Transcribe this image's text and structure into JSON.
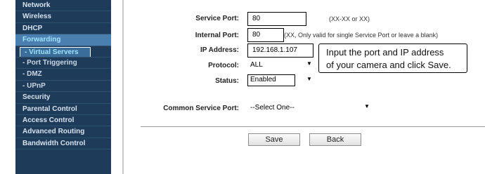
{
  "sidebar": {
    "items": [
      {
        "label": "Network"
      },
      {
        "label": "Wireless"
      },
      {
        "label": "DHCP"
      },
      {
        "label": "Forwarding"
      },
      {
        "label": "- Virtual Servers"
      },
      {
        "label": "- Port Triggering"
      },
      {
        "label": "- DMZ"
      },
      {
        "label": "- UPnP"
      },
      {
        "label": "Security"
      },
      {
        "label": "Parental Control"
      },
      {
        "label": "Access Control"
      },
      {
        "label": "Advanced Routing"
      },
      {
        "label": "Bandwidth Control"
      }
    ]
  },
  "form": {
    "service_port": {
      "label": "Service Port:",
      "value": "80",
      "hint": "(XX-XX or XX)"
    },
    "internal_port": {
      "label": "Internal Port:",
      "value": "80",
      "hint": "(XX, Only valid for single Service Port or leave a blank)"
    },
    "ip_address": {
      "label": "IP Address:",
      "value": "192.168.1.107"
    },
    "protocol": {
      "label": "Protocol:",
      "value": "ALL"
    },
    "status": {
      "label": "Status:",
      "value": "Enabled"
    },
    "common_service_port": {
      "label": "Common Service Port:",
      "value": "--Select One--"
    }
  },
  "callout": {
    "line1": "Input the port and IP address",
    "line2": "of your camera and click Save."
  },
  "buttons": {
    "save": "Save",
    "back": "Back"
  },
  "icons": {
    "dropdown": "triangle-down-icon"
  }
}
